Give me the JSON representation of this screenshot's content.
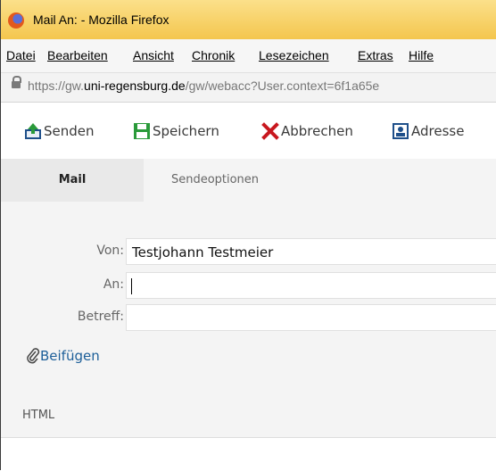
{
  "window": {
    "title": "Mail An: - Mozilla Firefox"
  },
  "menu": {
    "items": [
      "Datei",
      "Bearbeiten",
      "Ansicht",
      "Chronik",
      "Lesezeichen",
      "Extras",
      "Hilfe"
    ]
  },
  "address_bar": {
    "url_prefix": "https://gw.",
    "url_domain": "uni-regensburg.de",
    "url_path": "/gw/webacc?User.context=6f1a65e"
  },
  "toolbar": {
    "send_label": "Senden",
    "save_label": "Speichern",
    "cancel_label": "Abbrechen",
    "address_label": "Adresse"
  },
  "tabs": [
    {
      "label": "Mail"
    },
    {
      "label": "Sendeoptionen"
    }
  ],
  "form": {
    "from_label": "Von:",
    "from_value": "Testjohann Testmeier",
    "to_label": "An:",
    "to_value": "",
    "subject_label": "Betreff:",
    "subject_value": ""
  },
  "attach_label": "Beifügen",
  "format_label": "HTML"
}
